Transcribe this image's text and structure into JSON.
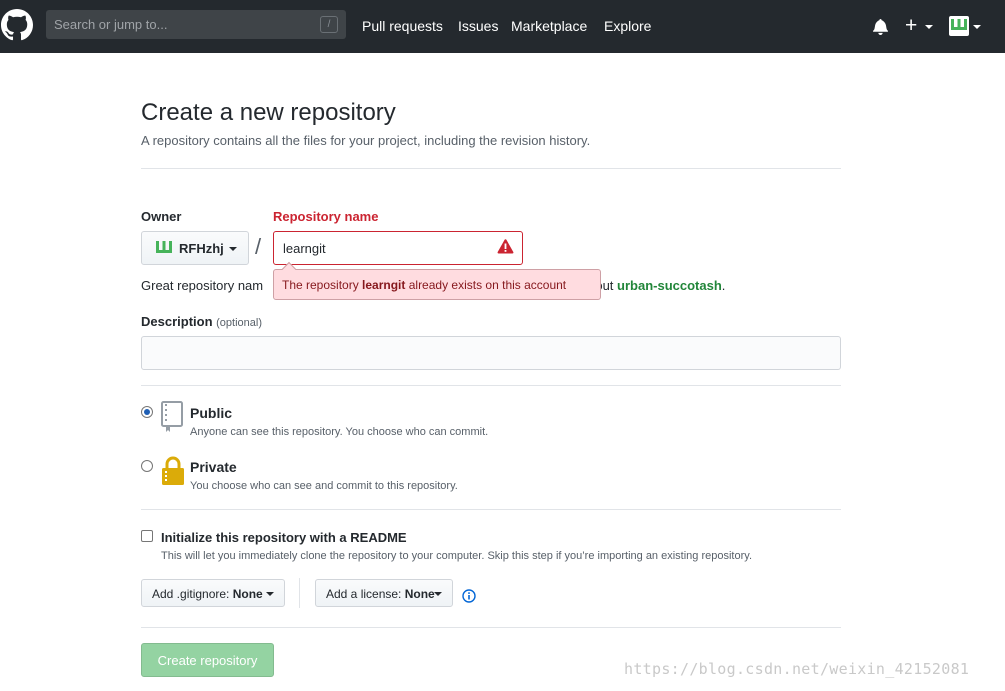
{
  "header": {
    "search_placeholder": "Search or jump to...",
    "search_shortcut": "/",
    "nav": [
      "Pull requests",
      "Issues",
      "Marketplace",
      "Explore"
    ],
    "plus": "+"
  },
  "page": {
    "title": "Create a new repository",
    "subtitle": "A repository contains all the files for your project, including the revision history."
  },
  "form": {
    "owner_label": "Owner",
    "owner_value": "RFHzhj",
    "separator": "/",
    "repo_label": "Repository name",
    "repo_value": "learngit",
    "great_prefix": "Great repository nam",
    "great_suffix": "bout ",
    "great_suggestion": "urban-succotash",
    "great_end": ".",
    "error_prefix": "The repository ",
    "error_repo": "learngit",
    "error_suffix": " already exists on this account",
    "description_label": "Description",
    "description_optional": "(optional)",
    "description_value": ""
  },
  "visibility": {
    "public_title": "Public",
    "public_note": "Anyone can see this repository. You choose who can commit.",
    "private_title": "Private",
    "private_note": "You choose who can see and commit to this repository.",
    "selected": "public"
  },
  "init": {
    "title": "Initialize this repository with a README",
    "note": "This will let you immediately clone the repository to your computer. Skip this step if you’re importing an existing repository.",
    "checked": false
  },
  "selects": {
    "gitignore_label": "Add .gitignore: ",
    "gitignore_value": "None",
    "license_label": "Add a license: ",
    "license_value": "None"
  },
  "submit_label": "Create repository",
  "watermark": "https://blog.csdn.net/weixin_42152081",
  "colors": {
    "header_bg": "#24292e",
    "error": "#cb2431",
    "success_green": "#22863a",
    "create_button": "#94d3a2"
  }
}
